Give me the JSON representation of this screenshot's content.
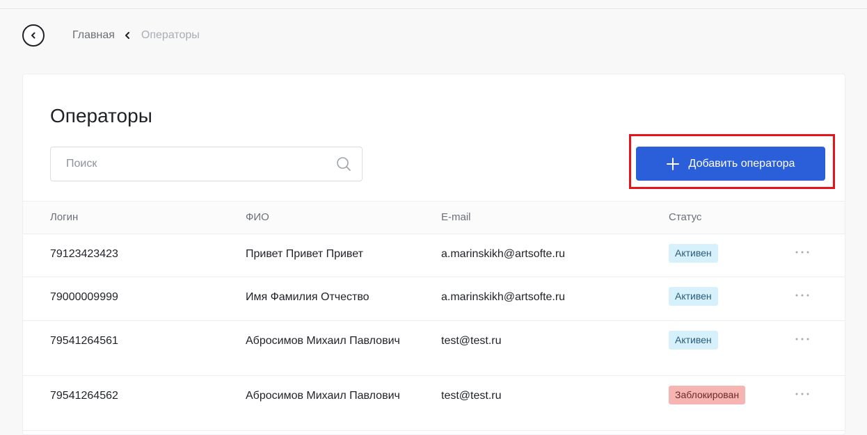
{
  "breadcrumb": {
    "home": "Главная",
    "current": "Операторы"
  },
  "page": {
    "title": "Операторы"
  },
  "search": {
    "placeholder": "Поиск",
    "value": ""
  },
  "toolbar": {
    "add_label": "Добавить оператора"
  },
  "colors": {
    "accent": "#2b5fd9",
    "highlight": "#e8121b",
    "status_active_bg": "#d6f1fb",
    "status_blocked_bg": "#f6b5b3"
  },
  "table": {
    "headers": {
      "login": "Логин",
      "fio": "ФИО",
      "email": "E-mail",
      "status": "Статус"
    },
    "rows": [
      {
        "login": "79123423423",
        "fio": "Привет Привет Привет",
        "email": "a.marinskikh@artsofte.ru",
        "status": "Активен"
      },
      {
        "login": "79000009999",
        "fio": "Имя Фамилия Отчество",
        "email": "a.marinskikh@artsofte.ru",
        "status": "Активен"
      },
      {
        "login": "79541264561",
        "fio": "Абросимов Михаил Павлович",
        "email": "test@test.ru",
        "status": "Активен"
      },
      {
        "login": "79541264562",
        "fio": "Абросимов Михаил Павлович",
        "email": "test@test.ru",
        "status": "Заблокирован"
      }
    ]
  },
  "icons": {
    "back": "chevron-left-circle-icon",
    "separator": "chevron-left-icon",
    "search": "search-icon",
    "add": "plus-icon",
    "more": "more-dots-icon"
  }
}
